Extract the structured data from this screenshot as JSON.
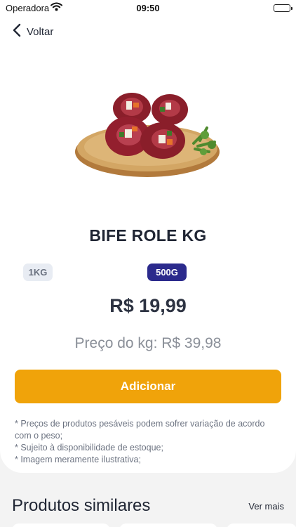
{
  "status_bar": {
    "carrier": "Operadora",
    "time": "09:50",
    "icons": [
      "wifi-icon",
      "battery-icon"
    ]
  },
  "nav": {
    "back_label": "Voltar",
    "back_icon": "chevron-left-icon"
  },
  "product": {
    "image": "product-image-bife-role",
    "name": "BIFE ROLE KG",
    "weight_options": [
      {
        "label": "1KG",
        "selected": false
      },
      {
        "label": "500G",
        "selected": true
      }
    ],
    "price": "R$ 19,99",
    "price_per_kg": "Preço do kg: R$ 39,98",
    "add_button_label": "Adicionar",
    "notes": [
      "* Preços de produtos pesáveis podem sofrer variação de acordo com o peso;",
      "* Sujeito à disponibilidade de estoque;",
      "* Imagem meramente ilustrativa;"
    ]
  },
  "similar": {
    "title": "Produtos similares",
    "see_more_label": "Ver mais"
  },
  "colors": {
    "accent": "#f0a30a",
    "selected_chip": "#2b2a8c",
    "unselected_chip": "#e8ecf3",
    "text_dark": "#1f2533",
    "text_muted": "#8a8f98"
  }
}
